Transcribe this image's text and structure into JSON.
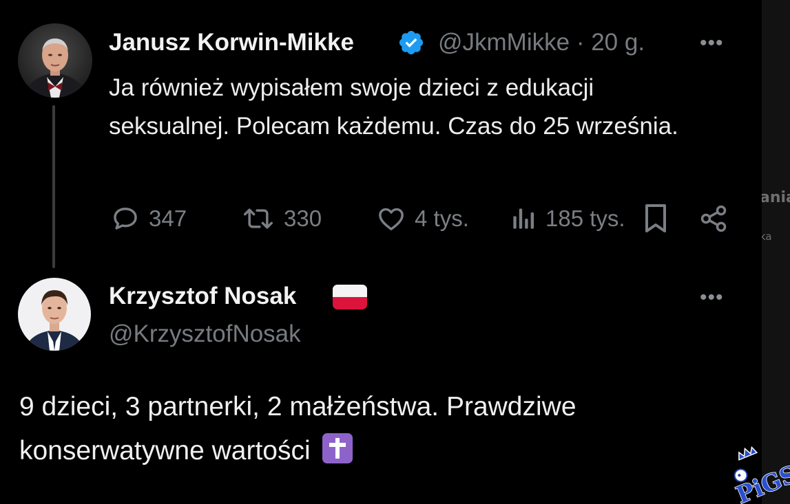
{
  "tweet": {
    "author_name": "Janusz Korwin-Mikke",
    "verified_icon": "verified-badge-icon",
    "handle": "@JkmMikke",
    "separator": "·",
    "time": "20 g.",
    "more_icon": "•••",
    "text": "Ja również wypisałem swoje dzieci z edukacji seksualnej. Polecam każdemu. Czas do 25 września.",
    "actions": {
      "replies": "347",
      "reposts": "330",
      "likes": "4 tys.",
      "views": "185 tys."
    }
  },
  "reply": {
    "author_name": "Krzysztof Nosak",
    "flag_icon": "poland-flag-icon",
    "handle": "@KrzysztofNosak",
    "more_icon": "•••",
    "text": "9 dzieci, 3 partnerki, 2 małżeństwa. Prawdziwe konserwatywne wartości",
    "emoji_icon": "latin-cross-emoji-icon"
  },
  "side_panel": {
    "text_a": "ania",
    "text_b": "ka"
  },
  "watermark": {
    "text": "PiGS"
  },
  "colors": {
    "background": "#000000",
    "text_primary": "#e7e9ea",
    "text_secondary": "#7b7f84",
    "verified_blue": "#1d9bf0",
    "thread_line": "#3b3b3b",
    "emoji_purple": "#8e63c9",
    "flag_red": "#dc143c"
  }
}
